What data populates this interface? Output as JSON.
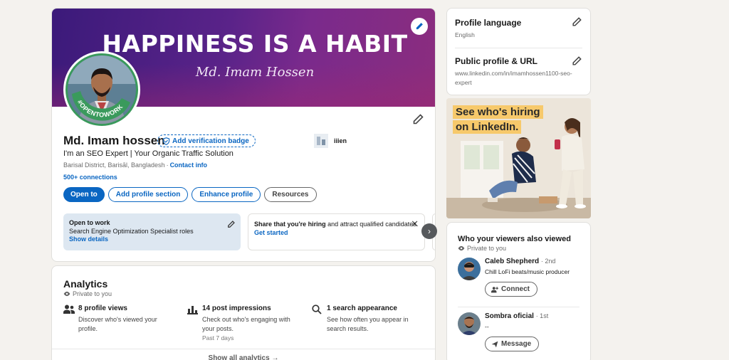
{
  "profile": {
    "banner_headline": "HAPPINESS IS A HABIT",
    "banner_signature": "Md. Imam Hossen",
    "open_to_work_ring": "#OPENTOWORK",
    "name": "Md. Imam hossen",
    "verification_badge": "Add verification badge",
    "headline": "I'm an SEO Expert | Your Organic Traffic Solution",
    "location": "Barisal District, Barisāl, Bangladesh",
    "location_sep": "·",
    "contact_info": "Contact info",
    "connections": "500+ connections",
    "company": "iiien",
    "buttons": {
      "open_to": "Open to",
      "add_profile_section": "Add profile section",
      "enhance_profile": "Enhance profile",
      "resources": "Resources"
    },
    "open_to_work_box": {
      "title": "Open to work",
      "text": "Search Engine Optimization Specialist roles",
      "link": "Show details"
    },
    "hiring_box": {
      "strong": "Share that you're hiring",
      "text": " and attract qualified candidates.",
      "link": "Get started"
    }
  },
  "analytics": {
    "title": "Analytics",
    "privacy": "Private to you",
    "metrics": [
      {
        "title": "8 profile views",
        "desc": "Discover who's viewed your profile.",
        "icon": "people-icon"
      },
      {
        "title": "14 post impressions",
        "desc": "Check out who's engaging with your posts.",
        "sub": "Past 7 days",
        "icon": "bar-chart-icon"
      },
      {
        "title": "1 search appearance",
        "desc": "See how often you appear in search results.",
        "icon": "search-icon"
      }
    ],
    "show_all": "Show all analytics →"
  },
  "sidebar": {
    "profile_language": {
      "title": "Profile language",
      "value": "English"
    },
    "public_profile": {
      "title": "Public profile & URL",
      "value": "www.linkedin.com/in/imamhossen1100-seo-expert"
    },
    "ad": {
      "line1": "See who's hiring",
      "line2": "on LinkedIn."
    },
    "viewers": {
      "title": "Who your viewers also viewed",
      "privacy": "Private to you",
      "people": [
        {
          "name": "Caleb Shepherd",
          "degree": "· 2nd",
          "headline": "Chill LoFi beats/music producer",
          "button": "Connect"
        },
        {
          "name": "Sombra oficial",
          "degree": "· 1st",
          "headline": "--",
          "button": "Message"
        }
      ]
    }
  },
  "colors": {
    "accent": "#0a66c2",
    "banner_start": "#3b1a7a",
    "banner_end": "#8b2d7e",
    "open_to_work": "#3a9a5c",
    "ad_highlight": "#f7c96b"
  }
}
